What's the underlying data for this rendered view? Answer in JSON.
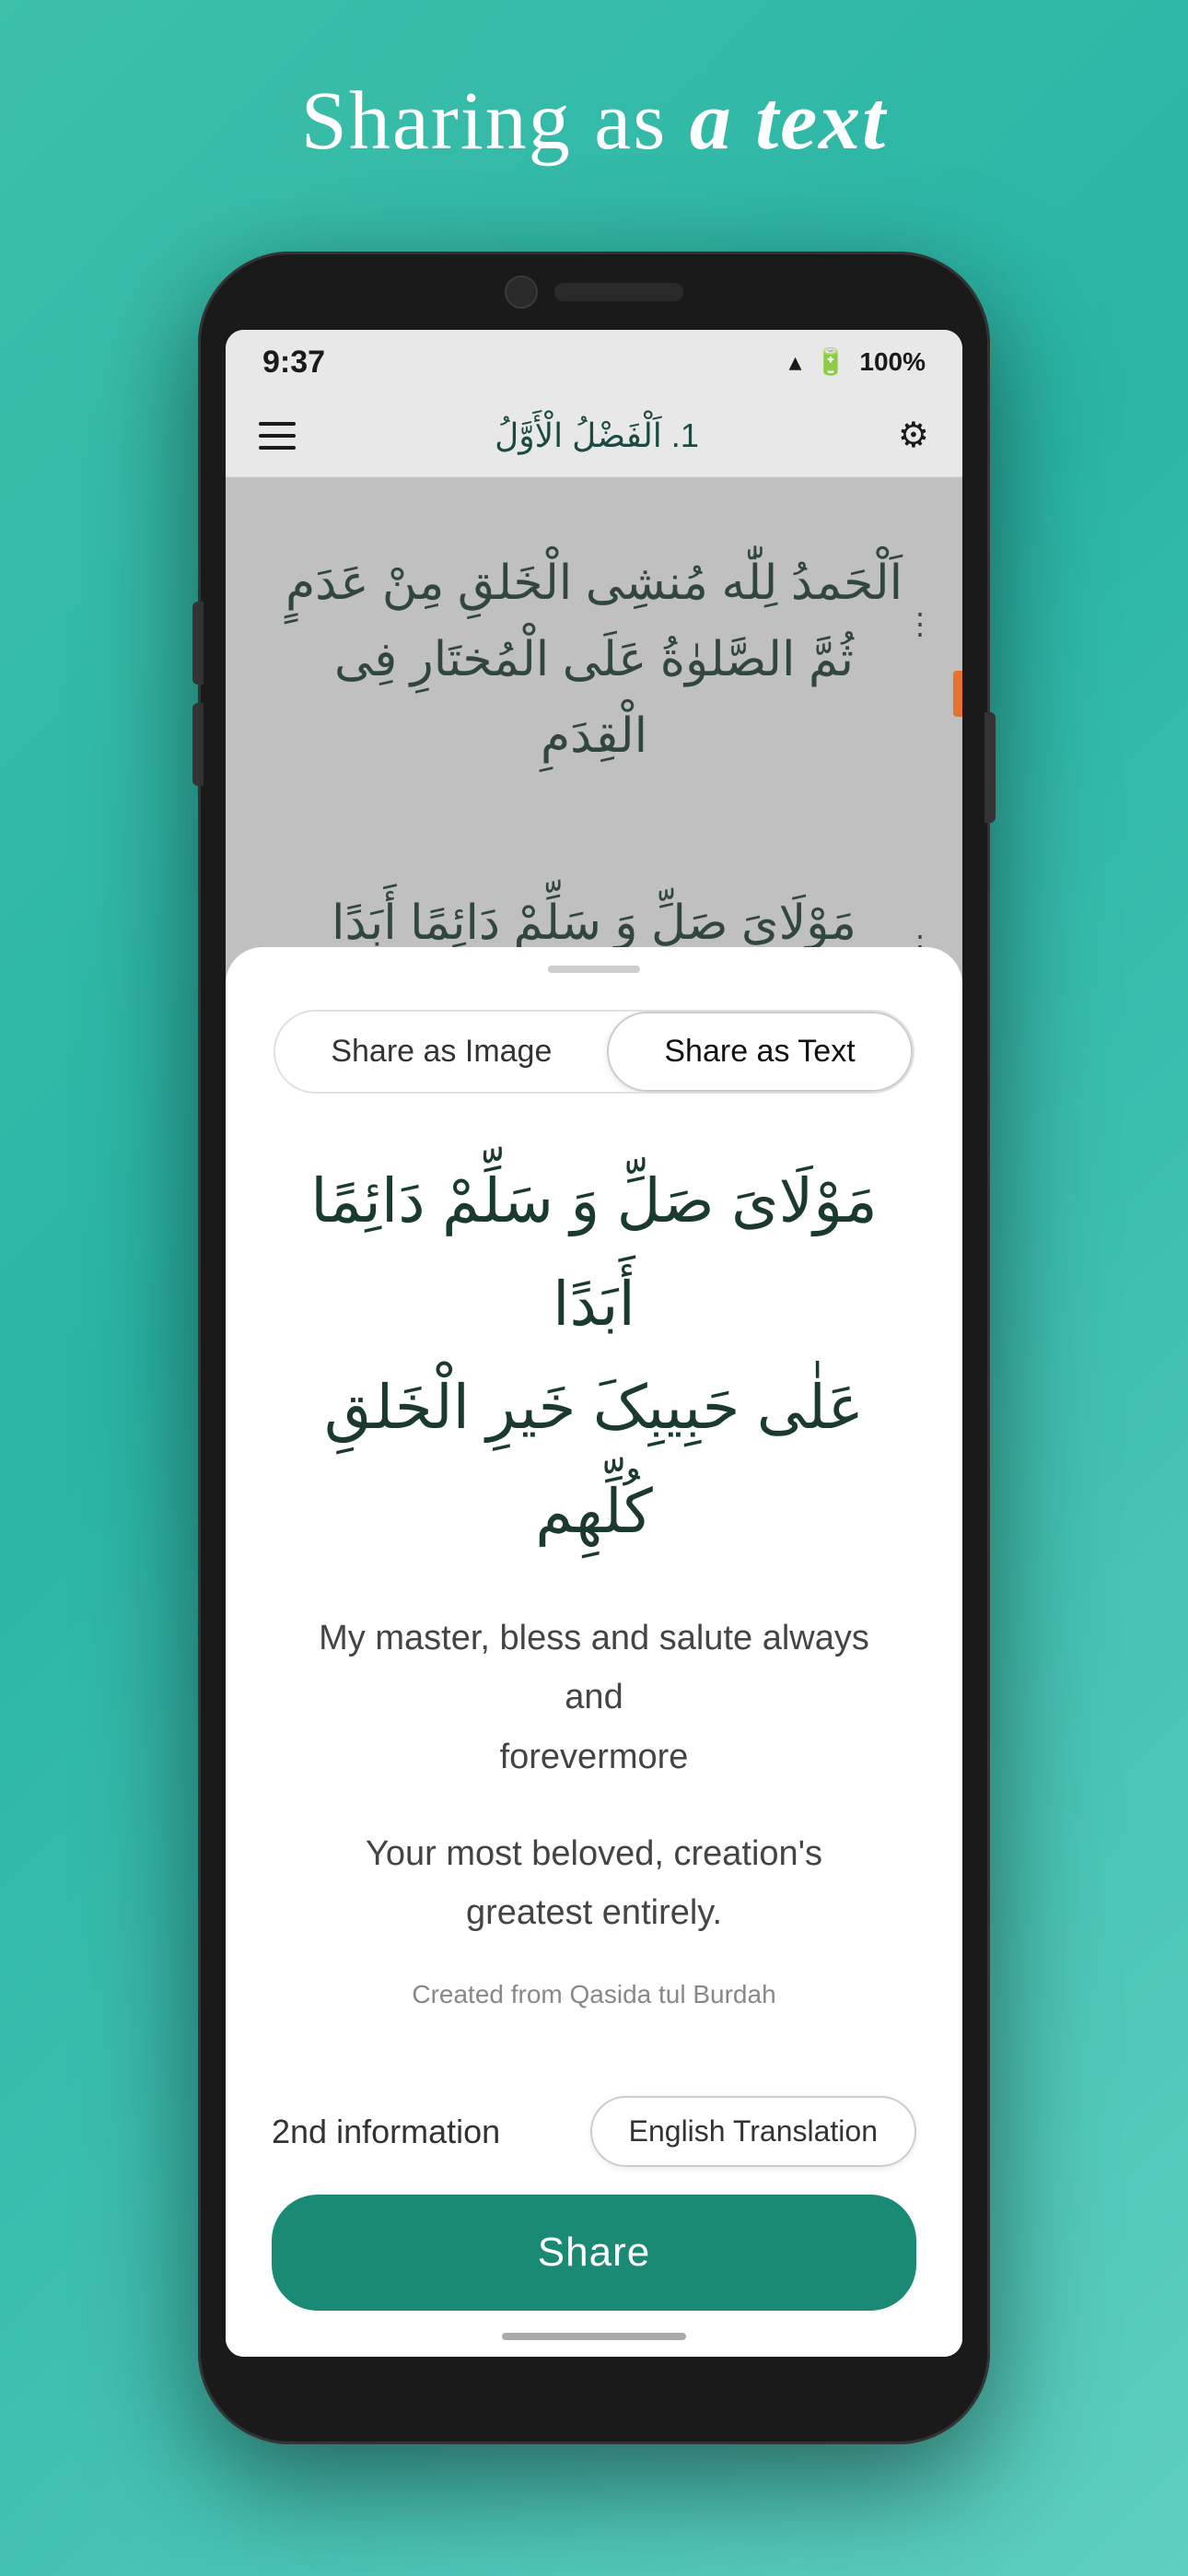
{
  "page": {
    "title_prefix": "Sharing as ",
    "title_italic": "a text"
  },
  "status_bar": {
    "time": "9:37",
    "battery": "100%"
  },
  "app_bar": {
    "title": "1. اَلْفَضْلُ الْأَوَّلُ"
  },
  "arabic_verses": {
    "verse1_line1": "اَلْحَمدُ لِلّٰه مُنشِی الْخَلقِ مِنْ عَدَمٍ",
    "verse1_line2": "ثُمَّ الصَّلوٰةُ عَلَی الْمُختَارِ فِی الْقِدَمِ",
    "verse2_line1": "مَوْلَایَ صَلِّ وَ سَلِّمْ دَائِمًا أَبَدًا"
  },
  "bottom_sheet": {
    "tab_image": "Share as Image",
    "tab_text": "Share as Text",
    "arabic_line1": "مَوْلَایَ صَلِّ وَ سَلِّمْ دَائِمًا أَبَدًا",
    "arabic_line2": "عَلٰی حَبِيبِکَ خَيرِ الْخَلقِ کُلِّهِم",
    "english_line1": "My master, bless and salute always and",
    "english_line2": "forevermore",
    "english_line3": "Your most beloved, creation's greatest entirely.",
    "credit": "Created from Qasida tul Burdah",
    "info_label": "2nd information",
    "translation_btn": "English Translation",
    "share_btn": "Share"
  }
}
